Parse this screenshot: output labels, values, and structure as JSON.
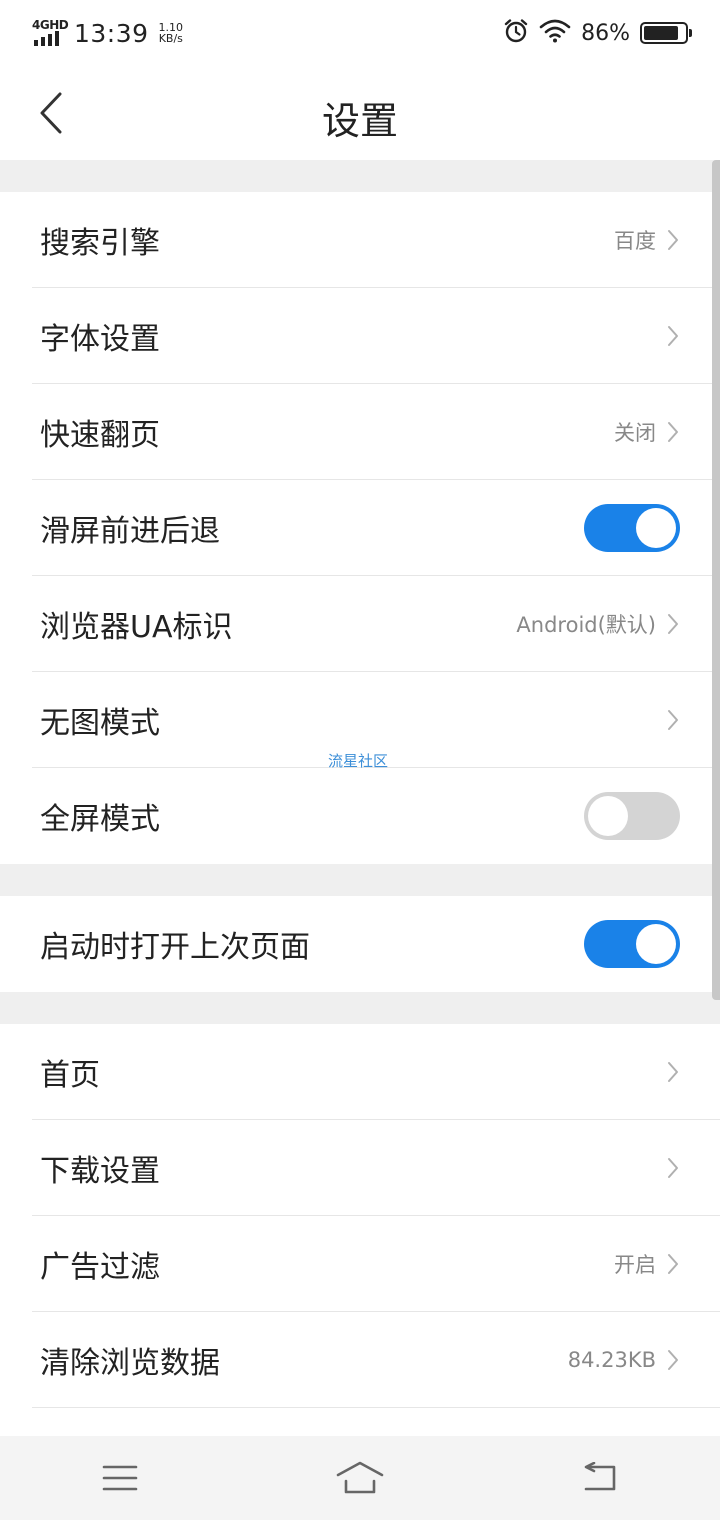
{
  "status_bar": {
    "network": "4GHD",
    "time": "13:39",
    "speed_value": "1.10",
    "speed_unit": "KB/s",
    "battery_percent": "86%",
    "battery_level": 0.86,
    "icons": [
      "alarm-icon",
      "wifi-icon",
      "battery-icon"
    ]
  },
  "header": {
    "title": "设置",
    "back_icon": "chevron-left-icon"
  },
  "sections": [
    {
      "rows": [
        {
          "label": "搜索引擎",
          "value": "百度",
          "type": "link"
        },
        {
          "label": "字体设置",
          "value": "",
          "type": "link"
        },
        {
          "label": "快速翻页",
          "value": "关闭",
          "type": "link"
        },
        {
          "label": "滑屏前进后退",
          "type": "toggle",
          "on": true
        },
        {
          "label": "浏览器UA标识",
          "value": "Android(默认)",
          "type": "link"
        },
        {
          "label": "无图模式",
          "value": "",
          "type": "link"
        },
        {
          "label": "全屏模式",
          "type": "toggle",
          "on": false
        }
      ]
    },
    {
      "rows": [
        {
          "label": "启动时打开上次页面",
          "type": "toggle",
          "on": true
        }
      ]
    },
    {
      "rows": [
        {
          "label": "首页",
          "value": "",
          "type": "link"
        },
        {
          "label": "下载设置",
          "value": "",
          "type": "link"
        },
        {
          "label": "广告过滤",
          "value": "开启",
          "type": "link"
        },
        {
          "label": "清除浏览数据",
          "value": "84.23KB",
          "type": "link"
        }
      ]
    }
  ],
  "watermark": "流星社区",
  "nav_bar": {
    "icons": [
      "menu-icon",
      "home-icon",
      "back-icon"
    ]
  },
  "colors": {
    "accent": "#1a82e8",
    "toggle_off": "#d4d4d4",
    "section_gap": "#efefef",
    "value_text": "#888888",
    "watermark": "#3d8fd8"
  }
}
